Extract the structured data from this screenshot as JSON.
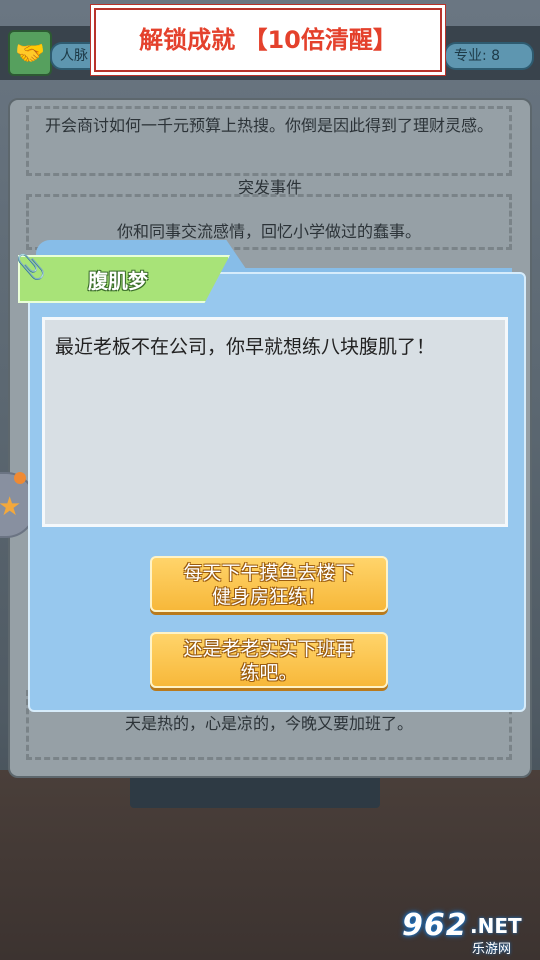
{
  "banner": {
    "text": "解锁成就 【10倍清醒】"
  },
  "header": {
    "left_pill": "人脉",
    "right_pill": "专业: 8"
  },
  "log": {
    "entry_top": "开会商讨如何一千元预算上热搜。你倒是因此得到了理财灵感。",
    "heading": "突发事件",
    "entry_mid": "你和同事交流感情，回忆小学做过的蠢事。",
    "entry_bottom": "天是热的，心是凉的，今晚又要加班了。"
  },
  "dialog": {
    "title": "腹肌梦",
    "body": "最近老板不在公司，你早就想练八块腹肌了！",
    "choices": [
      {
        "label": "每天下午摸鱼去楼下\n健身房狂练！"
      },
      {
        "label": "还是老老实实下班再\n练吧。"
      }
    ]
  },
  "watermark": {
    "num": "962",
    "net": ".NET",
    "sub": "乐游网"
  },
  "colors": {
    "banner_text": "#e4412c",
    "dialog_bg": "#97c8ee",
    "title_tab": "#a8e378",
    "choice_button": "#f7b83a"
  },
  "icons": [
    "handshake-icon",
    "paperclip-icon",
    "star-icon"
  ]
}
